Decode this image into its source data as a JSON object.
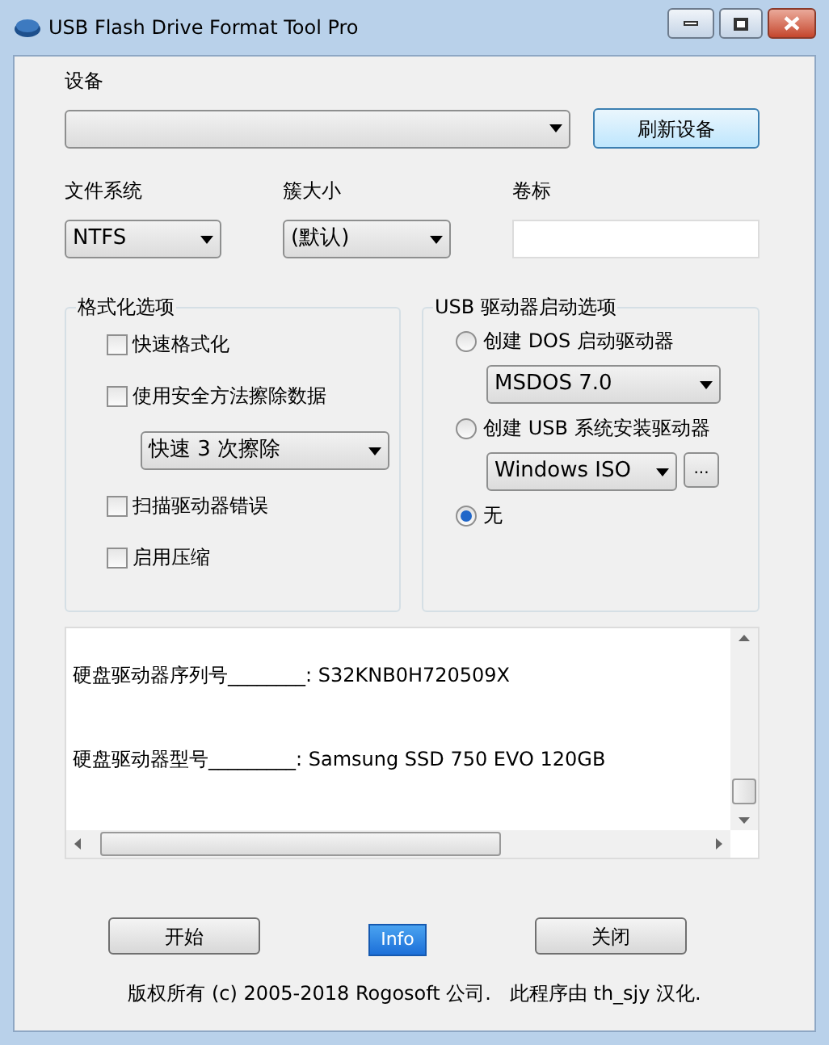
{
  "window": {
    "title": "USB Flash Drive Format Tool Pro"
  },
  "device": {
    "label": "设备",
    "refresh_button": "刷新设备"
  },
  "file_system": {
    "label": "文件系统",
    "value": "NTFS"
  },
  "cluster_size": {
    "label": "簇大小",
    "value": "(默认)"
  },
  "volume_label": {
    "label": "卷标"
  },
  "format_options": {
    "title": "格式化选项",
    "items": [
      {
        "kind": "checkbox",
        "label": "快速格式化",
        "checked": false
      },
      {
        "kind": "checkbox",
        "label": "使用安全方法擦除数据",
        "checked": false
      },
      {
        "kind": "dropdown",
        "value": "快速 3 次擦除"
      },
      {
        "kind": "checkbox",
        "label": "扫描驱动器错误",
        "checked": false
      },
      {
        "kind": "checkbox",
        "label": "启用压缩",
        "checked": false
      }
    ]
  },
  "usb_boot_options": {
    "title": "USB 驱动器启动选项",
    "items": [
      {
        "kind": "radio",
        "label": "创建 DOS 启动驱动器",
        "selected": false
      },
      {
        "kind": "dropdown",
        "value": "MSDOS 7.0"
      },
      {
        "kind": "radio",
        "label": "创建 USB 系统安装驱动器",
        "selected": false
      },
      {
        "kind": "dropdown_browse",
        "value": "Windows ISO",
        "browse": "..."
      },
      {
        "kind": "radio",
        "label": "无",
        "selected": true
      }
    ]
  },
  "log": [
    {
      "label": "硬盘驱动器序列号________",
      "value": ": S32KNB0H720509X"
    },
    {
      "label": "硬盘驱动器型号_________",
      "value": ": Samsung SSD 750 EVO 120GB"
    }
  ],
  "buttons": [
    {
      "label": "开始",
      "kind": "normal"
    },
    {
      "label": "Info",
      "kind": "primary"
    },
    {
      "label": "关闭",
      "kind": "normal"
    }
  ],
  "footer": "版权所有 (c) 2005-2018 Rogosoft 公司.   此程序由 th_sjy 汉化."
}
